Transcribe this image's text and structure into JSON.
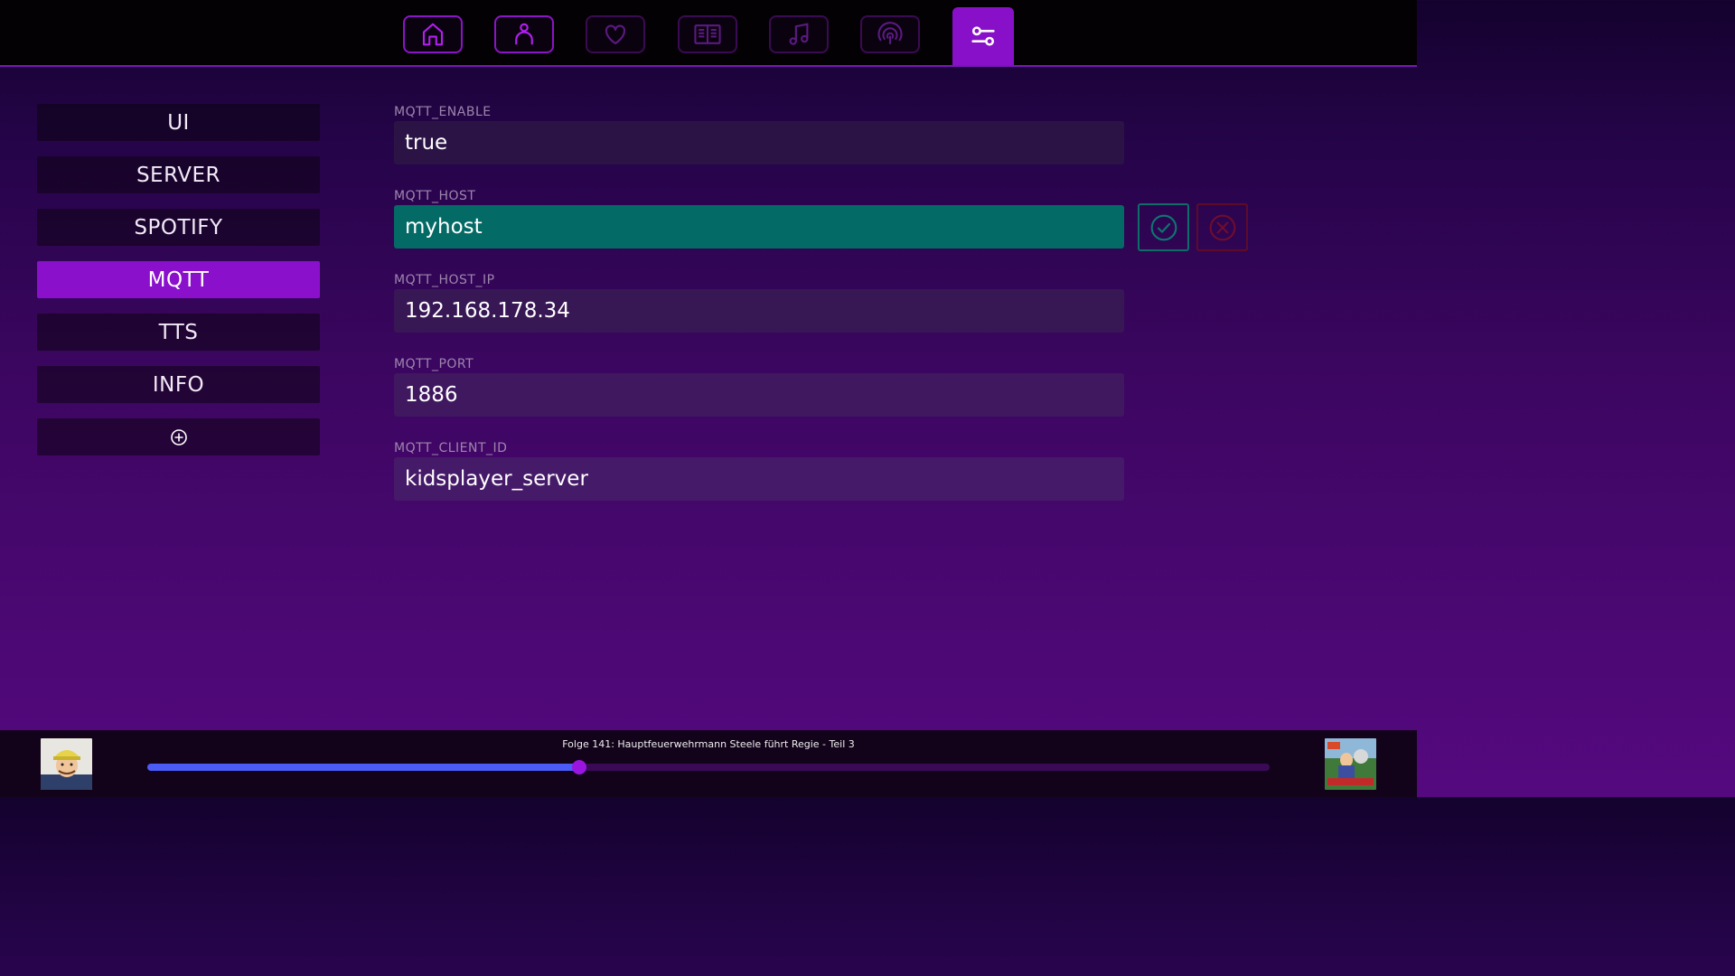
{
  "nav": {
    "tabs": [
      {
        "name": "home-icon"
      },
      {
        "name": "person-icon"
      },
      {
        "name": "heart-icon"
      },
      {
        "name": "book-icon"
      },
      {
        "name": "music-icon"
      },
      {
        "name": "podcast-icon"
      },
      {
        "name": "settings-sliders-icon"
      }
    ],
    "active": "settings-sliders-icon"
  },
  "sidebar": {
    "items": [
      {
        "label": "UI"
      },
      {
        "label": "SERVER"
      },
      {
        "label": "SPOTIFY"
      },
      {
        "label": "MQTT"
      },
      {
        "label": "TTS"
      },
      {
        "label": "INFO"
      }
    ],
    "active": "MQTT",
    "add_icon": "add-circle-icon"
  },
  "form": {
    "fields": [
      {
        "label": "MQTT_ENABLE",
        "value": "true"
      },
      {
        "label": "MQTT_HOST",
        "value": "myhost"
      },
      {
        "label": "MQTT_HOST_IP",
        "value": "192.168.178.34"
      },
      {
        "label": "MQTT_PORT",
        "value": "1886"
      },
      {
        "label": "MQTT_CLIENT_ID",
        "value": "kidsplayer_server"
      }
    ],
    "editing": "MQTT_HOST",
    "confirm_icon": "check-circle-icon",
    "cancel_icon": "x-circle-icon"
  },
  "player": {
    "track_title": "Folge 141: Hauptfeuerwehrmann Steele führt Regie - Teil 3",
    "progress": 0.385
  },
  "colors": {
    "accent": "#8b10cc",
    "edit_field": "#046a65",
    "progress_fill": "#4a5cf5",
    "knob": "#9a16e0"
  }
}
